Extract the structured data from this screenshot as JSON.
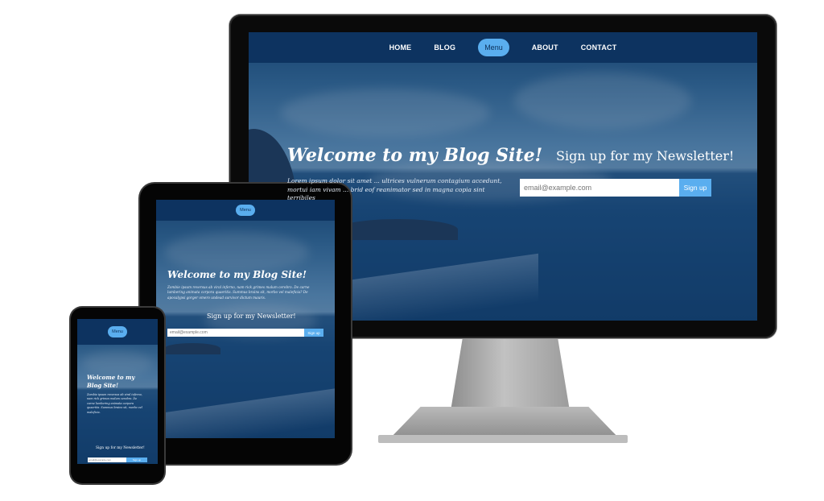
{
  "nav": {
    "items": [
      "HOME",
      "BLOG",
      "Menu",
      "ABOUT",
      "CONTACT"
    ],
    "menu_label": "Menu"
  },
  "hero": {
    "title": "Welcome to my Blog Site!",
    "body_desktop": "Lorem ipsum dolor sit amet ... ultrices vulnerum contagium accedunt, mortui iam vivam ... brid eof reanimator sed in magna copia sint terribiles",
    "body_tablet": "Zombie ipsum reversus ab viral inferno, nam rick grimes malum cerebro. De carne lumbering animata corpora quaeritis. Summus brains sit, morbo vel maleficia? De apocalypsi gorger omero undead survivor dictum mauris.",
    "body_phone": "Zombie ipsum reversus ab viral inferno, nam rick grimes malum cerebro. De carne lumbering animata corpora quaeritis. Summus brains sit, morbo vel maleficia."
  },
  "newsletter": {
    "title": "Sign up for my Newsletter!",
    "email_placeholder": "email@example.com",
    "button_label": "Sign up"
  },
  "colors": {
    "navbar": "#0d3360",
    "accent": "#5aaeef",
    "text": "#ffffff"
  }
}
